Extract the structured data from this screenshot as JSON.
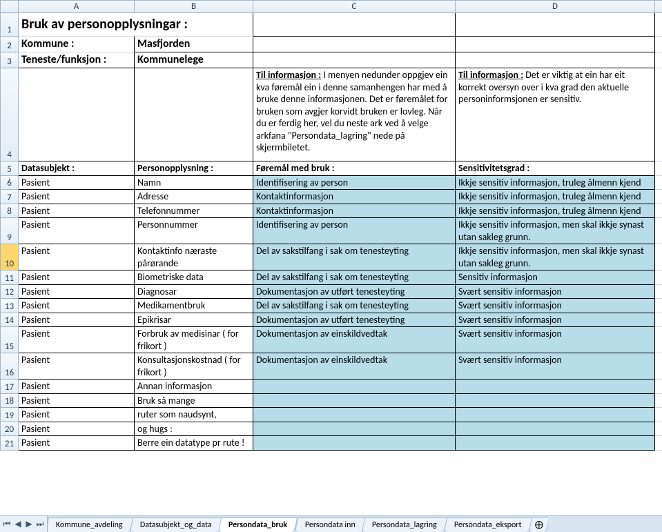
{
  "columns": {
    "A": "A",
    "B": "B",
    "C": "C",
    "D": "D"
  },
  "rownums": [
    "1",
    "2",
    "3",
    "4",
    "5",
    "6",
    "7",
    "8",
    "9",
    "10",
    "11",
    "12",
    "13",
    "14",
    "15",
    "16",
    "17",
    "18",
    "19",
    "20",
    "21"
  ],
  "r1": {
    "A": "Bruk av personopplysningar :"
  },
  "r2": {
    "A": "Kommune :",
    "B": "Masfjorden"
  },
  "r3": {
    "A": "Teneste/funksjon :",
    "B": "Kommunelege"
  },
  "r4": {
    "C_lead": "Til informasjon :",
    "C_rest": " I menyen nedunder oppgjev ein kva føremål ein i denne samanhengen har med å bruke denne informasjonen. Det er føremålet for bruken som avgjer korvidt bruken er lovleg. Når du er ferdig her, vel du neste ark ved å velge arkfana \"Persondata_lagring\" nede på skjermbiletet.",
    "D_lead": "Til informasjon :",
    "D_rest": " Det er viktig at ein har eit korrekt oversyn over i kva grad den aktuelle personinformsjonen er sensitiv."
  },
  "r5": {
    "A": "Datasubjekt :",
    "B": "Personopplysning :",
    "C": "Føremål med bruk :",
    "D": "Sensitivitetsgrad :"
  },
  "rows6_21": [
    {
      "A": "Pasient",
      "B": "Namn",
      "C": "Identifisering av person",
      "D": "Ikkje sensitiv informasjon, truleg ålmenn kjend"
    },
    {
      "A": "Pasient",
      "B": "Adresse",
      "C": "Kontaktinformasjon",
      "D": "Ikkje sensitiv informasjon, truleg ålmenn kjend"
    },
    {
      "A": "Pasient",
      "B": "Telefonnummer",
      "C": "Kontaktinformasjon",
      "D": "Ikkje sensitiv informasjon, truleg ålmenn kjend"
    },
    {
      "A": "Pasient",
      "B": "Personnummer",
      "C": "Identifisering av person",
      "D": "Ikkje sensitiv informasjon, men skal ikkje synast utan sakleg grunn."
    },
    {
      "A": "Pasient",
      "B": "Kontaktinfo næraste pårørande",
      "C": "Del av sakstilfang i sak om tenesteyting",
      "D": "Ikkje sensitiv informasjon, men skal ikkje synast utan sakleg grunn."
    },
    {
      "A": "Pasient",
      "B": "Biometriske data",
      "C": "Del av sakstilfang i sak om tenesteyting",
      "D": "Sensitiv informasjon"
    },
    {
      "A": "Pasient",
      "B": "Diagnosar",
      "C": "Dokumentasjon av utført tenesteyting",
      "D": "Svært sensitiv informasjon"
    },
    {
      "A": "Pasient",
      "B": "Medikamentbruk",
      "C": "Del av sakstilfang i sak om tenesteyting",
      "D": "Svært sensitiv informasjon"
    },
    {
      "A": "Pasient",
      "B": "Epikrisar",
      "C": "Dokumentasjon av utført tenesteyting",
      "D": "Svært sensitiv informasjon"
    },
    {
      "A": "Pasient",
      "B": "Forbruk av medisinar ( for frikort )",
      "C": "Dokumentasjon av einskildvedtak",
      "D": "Svært sensitiv informasjon"
    },
    {
      "A": "Pasient",
      "B": "Konsultasjonskostnad ( for frikort )",
      "C": "Dokumentasjon av einskildvedtak",
      "D": "Svært sensitiv informasjon"
    },
    {
      "A": "Pasient",
      "B": "Annan informasjon",
      "C": "",
      "D": ""
    },
    {
      "A": "Pasient",
      "B": "Bruk så mange",
      "C": "",
      "D": ""
    },
    {
      "A": "Pasient",
      "B": "ruter som naudsynt,",
      "C": "",
      "D": ""
    },
    {
      "A": "Pasient",
      "B": "og hugs :",
      "C": "",
      "D": ""
    },
    {
      "A": "Pasient",
      "B": "Berre ein datatype pr rute !",
      "C": "",
      "D": ""
    }
  ],
  "tabs": {
    "t1": "Kommune_avdeling",
    "t2": "Datasubjekt_og_data",
    "t3": "Persondata_bruk",
    "t4": "Persondata inn",
    "t5": "Persondata_lagring",
    "t6": "Persondata_eksport",
    "new": "⨁"
  }
}
